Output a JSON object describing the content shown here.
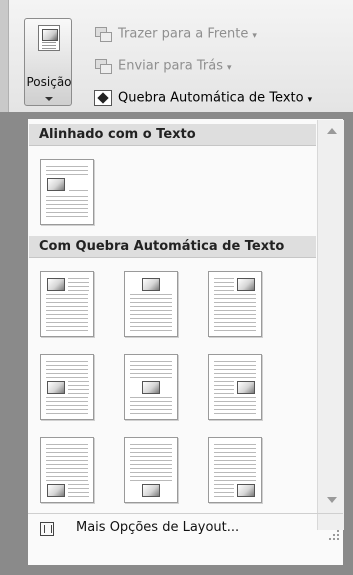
{
  "ribbon": {
    "position_button": {
      "label": "Posição"
    },
    "bring_forward": {
      "label": "Trazer para a Frente",
      "enabled": false
    },
    "send_backward": {
      "label": "Enviar para Trás",
      "enabled": false
    },
    "text_wrapping": {
      "label": "Quebra Automática de Texto",
      "enabled": true
    }
  },
  "dropdown": {
    "sections": [
      {
        "title": "Alinhado com o Texto",
        "options": [
          "inline"
        ]
      },
      {
        "title": "Com Quebra Automática de Texto",
        "options": [
          "top-left",
          "top-center",
          "top-right",
          "middle-left",
          "middle-center",
          "middle-right",
          "bottom-left",
          "bottom-center",
          "bottom-right"
        ]
      }
    ],
    "more_options": {
      "label": "Mais Opções de Layout..."
    }
  }
}
